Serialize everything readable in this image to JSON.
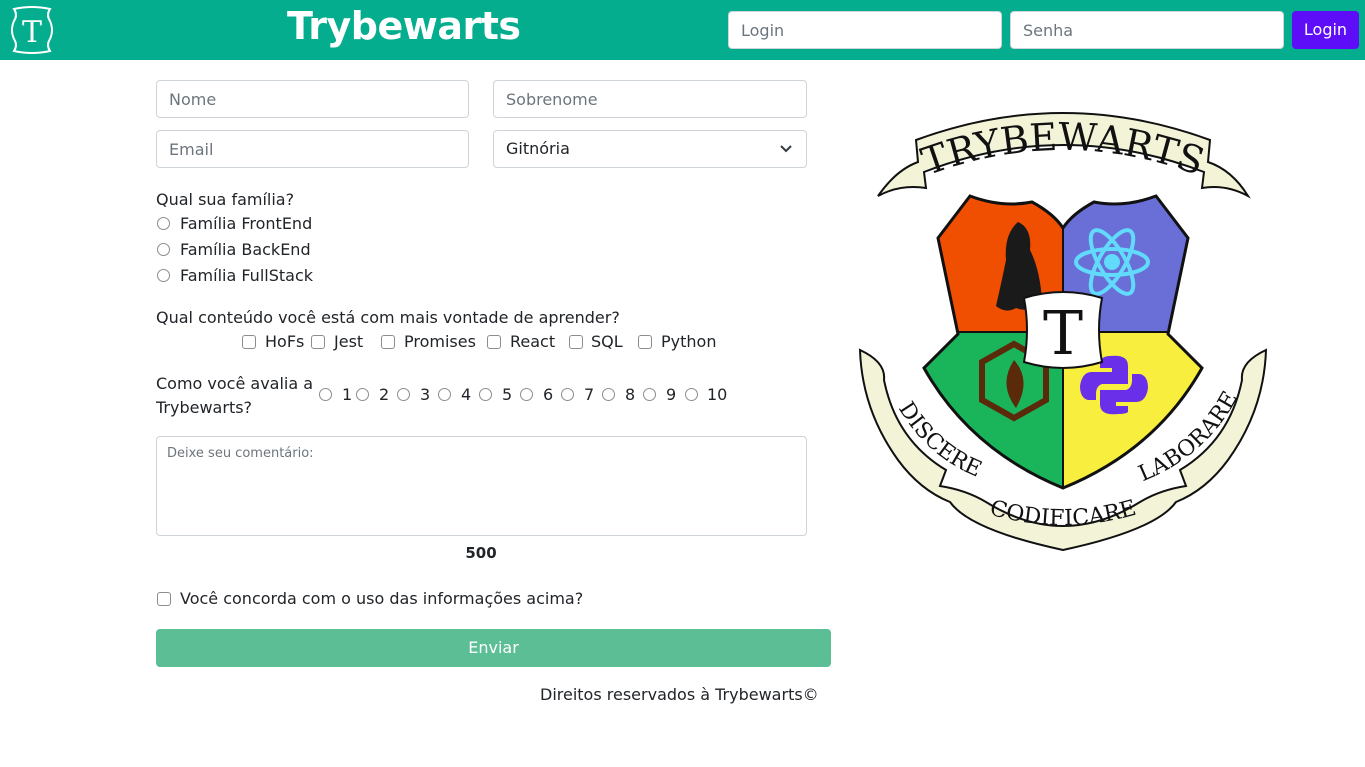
{
  "header": {
    "logo_letter": "T",
    "title": "Trybewarts",
    "login_placeholder": "Login",
    "password_placeholder": "Senha",
    "login_button": "Login",
    "bg_color": "#03ad8e",
    "button_color": "#5d0df8"
  },
  "form": {
    "nome_placeholder": "Nome",
    "sobrenome_placeholder": "Sobrenome",
    "email_placeholder": "Email",
    "house_selected": "Gitnória",
    "family_question": "Qual sua família?",
    "families": [
      "Família FrontEnd",
      "Família BackEnd",
      "Família FullStack"
    ],
    "content_question": "Qual conteúdo você está com mais vontade de aprender?",
    "contents": [
      "HoFs",
      "Jest",
      "Promises",
      "React",
      "SQL",
      "Python"
    ],
    "rate_question_line1": "Como você avalia a",
    "rate_question_line2": "Trybewarts?",
    "ratings": [
      "1",
      "2",
      "3",
      "4",
      "5",
      "6",
      "7",
      "8",
      "9",
      "10"
    ],
    "comment_placeholder": "Deixe seu comentário:",
    "counter": "500",
    "agreement": "Você concorda com o uso das informações acima?",
    "submit": "Enviar",
    "submit_color": "#5cbe94"
  },
  "crest": {
    "top_banner": "TRYBEWARTS",
    "center_letter": "T",
    "motto_left": "DISCERE",
    "motto_center": "CODIFICARE",
    "motto_right": "LABORARE",
    "quarter_colors": [
      "#f04e00",
      "#6a6fd8",
      "#1ab55b",
      "#f8ee3e"
    ]
  },
  "footer": {
    "text": "Direitos reservados à Trybewarts©"
  }
}
